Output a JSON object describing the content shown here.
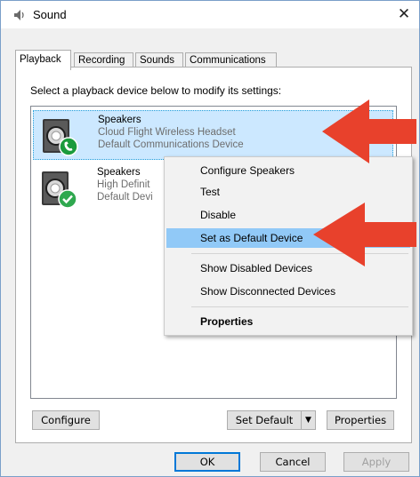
{
  "window": {
    "title": "Sound",
    "close_label": "✕"
  },
  "tabs": [
    {
      "label": "Playback",
      "active": true
    },
    {
      "label": "Recording",
      "active": false
    },
    {
      "label": "Sounds",
      "active": false
    },
    {
      "label": "Communications",
      "active": false
    }
  ],
  "playback": {
    "instruction": "Select a playback device below to modify its settings:",
    "devices": [
      {
        "name": "Speakers",
        "line1": "Cloud Flight Wireless Headset",
        "line2": "Default Communications Device",
        "badge": "phone-icon",
        "selected": true
      },
      {
        "name": "Speakers",
        "line1": "High Definit",
        "line2": "Default Devi",
        "badge": "checkmark-icon",
        "selected": false
      }
    ]
  },
  "buttons": {
    "configure": "Configure",
    "set_default": "Set Default",
    "properties": "Properties",
    "ok": "OK",
    "cancel": "Cancel",
    "apply": "Apply"
  },
  "context_menu": {
    "items": [
      {
        "label": "Configure Speakers"
      },
      {
        "label": "Test"
      },
      {
        "label": "Disable"
      },
      {
        "label": "Set as Default Device",
        "highlighted": true
      },
      {
        "label": "Show Disabled Devices"
      },
      {
        "label": "Show Disconnected Devices"
      },
      {
        "label": "Properties",
        "bold": true
      }
    ]
  },
  "colors": {
    "annotation_arrow": "#e8412c",
    "selection": "#cce8ff",
    "menu_highlight": "#91c9f7",
    "phone_badge": "#1a9b3c",
    "check_badge": "#2fa84f"
  },
  "icons": [
    "sound-icon",
    "speaker-icon",
    "phone-icon",
    "checkmark-icon",
    "dropdown-arrow-icon",
    "red-arrow-icon"
  ]
}
